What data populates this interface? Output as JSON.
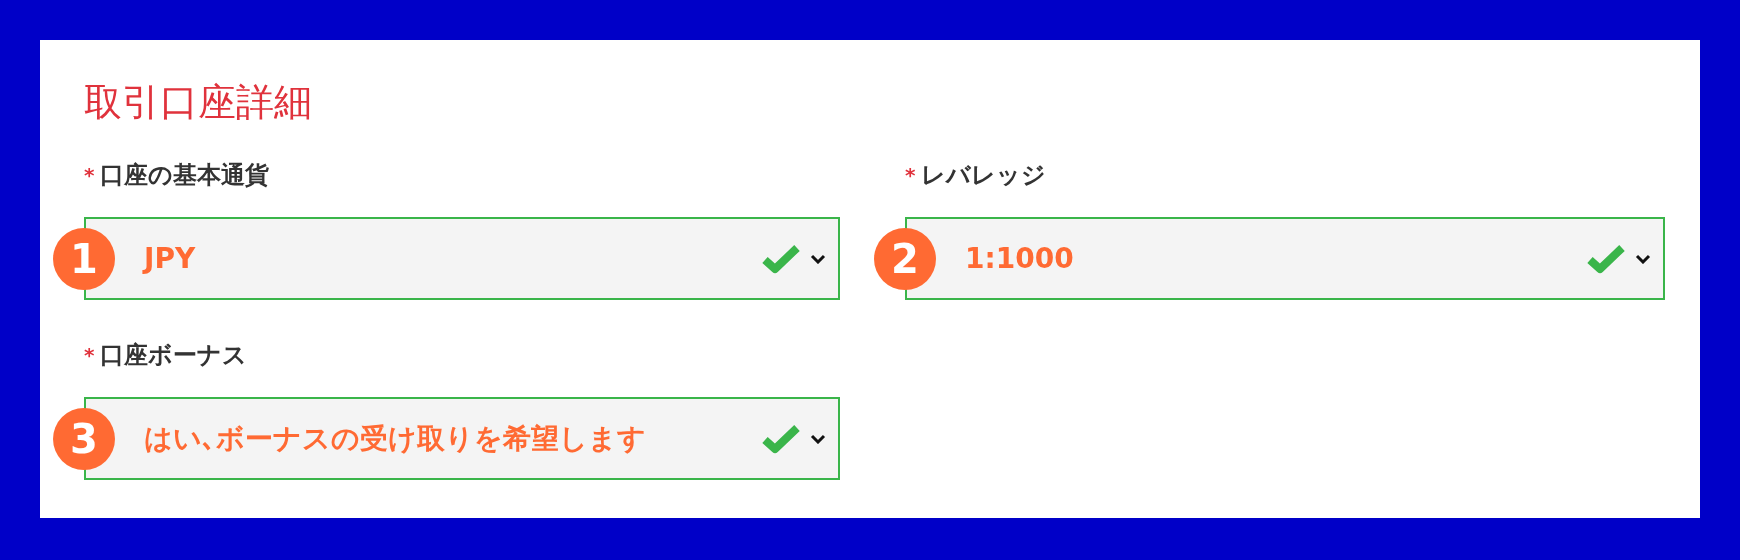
{
  "section": {
    "title": "取引口座詳細"
  },
  "fields": [
    {
      "required_mark": "*",
      "label": "口座の基本通貨",
      "badge": "1",
      "value": "JPY",
      "valid": true
    },
    {
      "required_mark": "*",
      "label": "レバレッジ",
      "badge": "2",
      "value": "1:1000",
      "valid": true
    },
    {
      "required_mark": "*",
      "label": "口座ボーナス",
      "badge": "3",
      "value": "はい､ボーナスの受け取りを希望します",
      "valid": true
    }
  ]
}
